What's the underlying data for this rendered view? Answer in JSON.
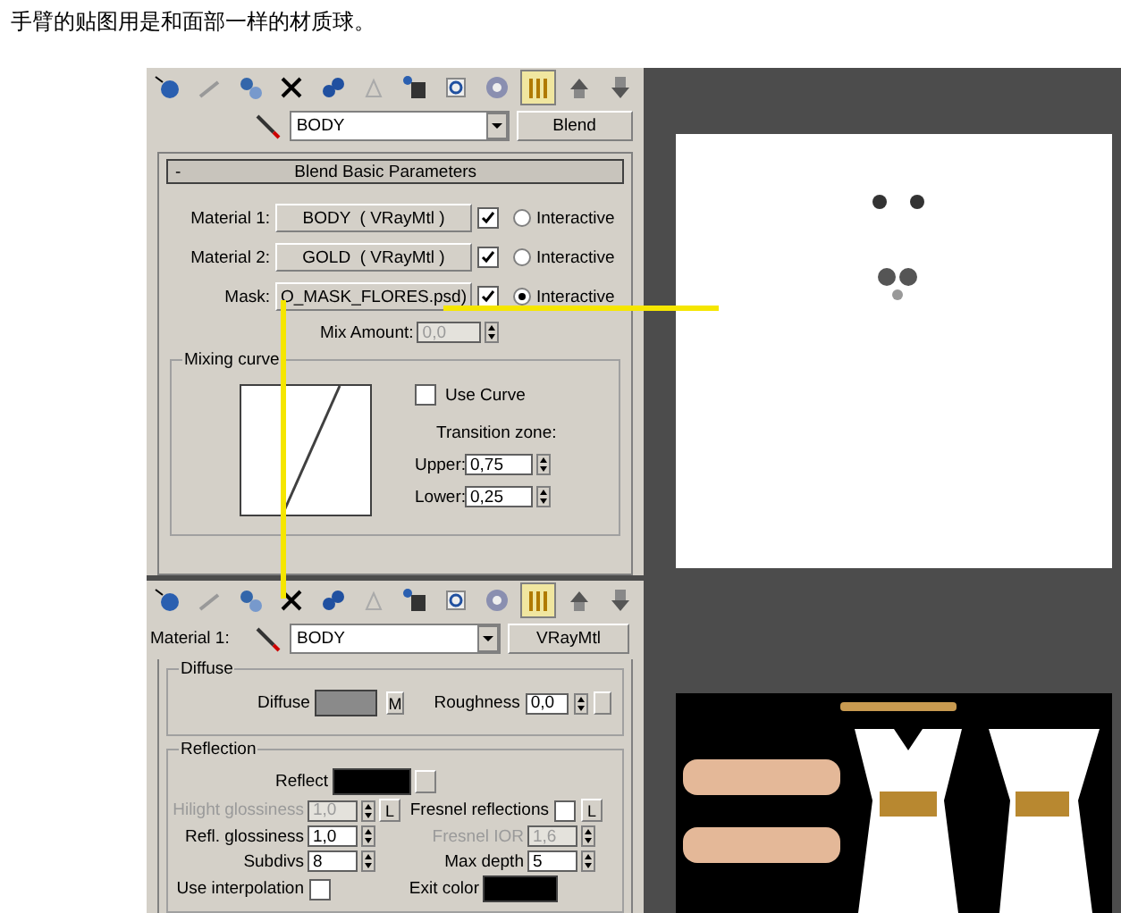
{
  "caption": "手臂的贴图用是和面部一样的材质球。",
  "blend_editor": {
    "tools": [
      {
        "selected": false
      },
      {
        "selected": false
      },
      {
        "selected": false
      },
      {
        "selected": false
      },
      {
        "selected": false
      },
      {
        "selected": false
      },
      {
        "selected": false
      },
      {
        "selected": false
      },
      {
        "selected": false
      },
      {
        "selected": true
      },
      {
        "selected": false
      },
      {
        "selected": false
      }
    ],
    "material_name": "BODY",
    "type_button": "Blend",
    "rollout_toggle": "-",
    "rollout_title": "Blend Basic Parameters",
    "materials": [
      {
        "label": "Material 1:",
        "button": "BODY  ( VRayMtl )",
        "checked": true,
        "selected": false,
        "radio_label": "Interactive"
      },
      {
        "label": "Material 2:",
        "button": "GOLD  ( VRayMtl )",
        "checked": true,
        "selected": false,
        "radio_label": "Interactive"
      },
      {
        "label": "Mask:",
        "button": "O_MASK_FLORES.psd)",
        "checked": true,
        "selected": true,
        "radio_label": "Interactive"
      }
    ],
    "mix_amount": {
      "label": "Mix Amount:",
      "value": "0,0",
      "disabled": true
    },
    "mixing_curve": {
      "title": "Mixing curve",
      "use_curve": {
        "label": "Use Curve",
        "checked": false
      },
      "transition_label": "Transition zone:",
      "fields": [
        {
          "label": "Upper:",
          "value": "0,75"
        },
        {
          "label": "Lower:",
          "value": "0,25"
        }
      ]
    }
  },
  "vray_editor": {
    "tools": [
      {
        "selected": false
      },
      {
        "selected": false
      },
      {
        "selected": false
      },
      {
        "selected": false
      },
      {
        "selected": false
      },
      {
        "selected": false
      },
      {
        "selected": false
      },
      {
        "selected": false
      },
      {
        "selected": false
      },
      {
        "selected": true
      },
      {
        "selected": false
      },
      {
        "selected": false
      }
    ],
    "slot_label": "Material 1:",
    "material_name": "BODY",
    "type_button": "VRayMtl",
    "diffuse": {
      "title": "Diffuse",
      "label": "Diffuse",
      "color": "#8a8a8a",
      "map_button": "M",
      "roughness_label": "Roughness",
      "roughness": "0,0"
    },
    "reflection": {
      "title": "Reflection",
      "reflect": {
        "label": "Reflect",
        "color": "#000000"
      },
      "rows": [
        [
          {
            "kind": "spinner",
            "label": "Hilight glossiness",
            "value": "1,0",
            "disabled": true,
            "lock": "L"
          },
          {
            "kind": "checkbox",
            "label": "Fresnel reflections",
            "checked": false,
            "lock": "L"
          }
        ],
        [
          {
            "kind": "spinner",
            "label": "Refl. glossiness",
            "value": "1,0",
            "disabled": false
          },
          {
            "kind": "spinner",
            "label": "Fresnel IOR",
            "value": "1,6",
            "disabled": true
          }
        ],
        [
          {
            "kind": "spinner",
            "label": "Subdivs",
            "value": "8",
            "disabled": false
          },
          {
            "kind": "spinner",
            "label": "Max depth",
            "value": "5",
            "disabled": false
          }
        ],
        [
          {
            "kind": "checkbox",
            "label": "Use interpolation",
            "checked": false
          },
          {
            "kind": "swatch",
            "label": "Exit color",
            "color": "#000000"
          }
        ]
      ]
    }
  }
}
